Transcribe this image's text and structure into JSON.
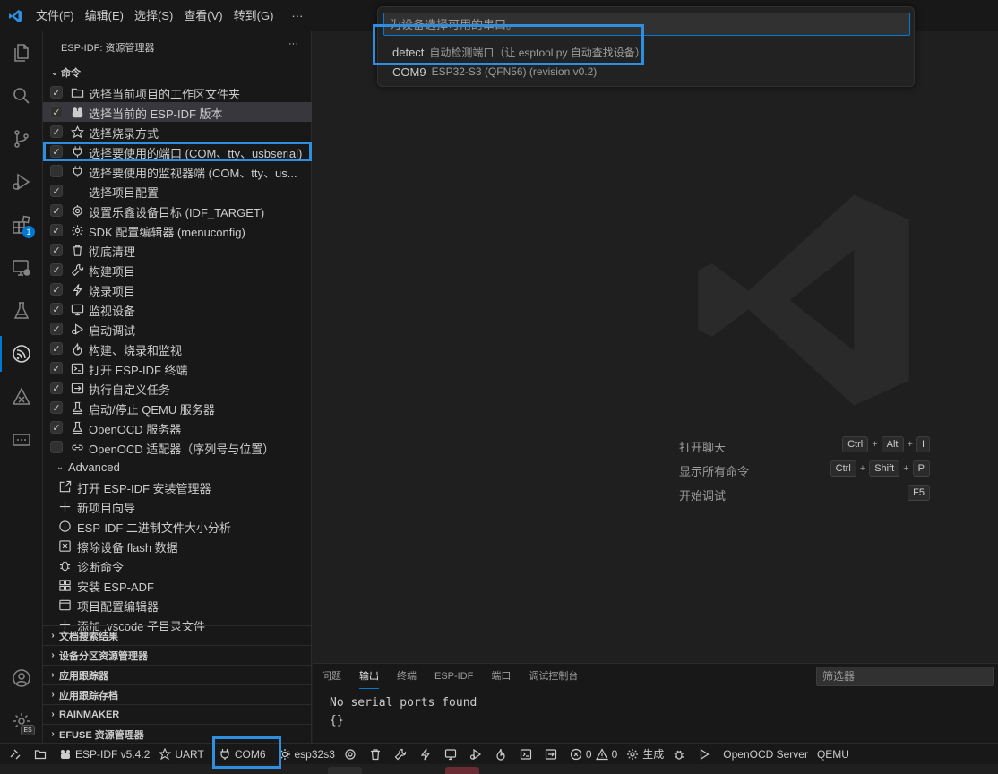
{
  "menu": {
    "items": [
      "文件(F)",
      "编辑(E)",
      "选择(S)",
      "查看(V)",
      "转到(G)",
      "···"
    ]
  },
  "activity": {
    "extensions_badge": "1",
    "settings_badge": "ES"
  },
  "sidebar": {
    "title": "ESP-IDF: 资源管理器",
    "more": "···",
    "section": "命令",
    "commands": [
      {
        "label": "选择当前项目的工作区文件夹",
        "icon": "folder-icon",
        "checked": true
      },
      {
        "label": "选择当前的 ESP-IDF 版本",
        "icon": "espressif-icon",
        "checked": true
      },
      {
        "label": "选择烧录方式",
        "icon": "star-icon",
        "checked": true
      },
      {
        "label": "选择要使用的端口 (COM、tty、usbserial)",
        "icon": "plug-icon",
        "checked": true
      },
      {
        "label": "选择要使用的监视器端 (COM、tty、us...",
        "icon": "plug-icon",
        "checked": false
      },
      {
        "label": "选择项目配置",
        "icon": "",
        "checked": true
      },
      {
        "label": "设置乐鑫设备目标 (IDF_TARGET)",
        "icon": "chip-gear-icon",
        "checked": true
      },
      {
        "label": "SDK 配置编辑器 (menuconfig)",
        "icon": "gear-icon",
        "checked": true
      },
      {
        "label": "彻底清理",
        "icon": "trash-icon",
        "checked": true
      },
      {
        "label": "构建项目",
        "icon": "wrench-icon",
        "checked": true
      },
      {
        "label": "烧录项目",
        "icon": "lightning-icon",
        "checked": true
      },
      {
        "label": "监视设备",
        "icon": "monitor-icon",
        "checked": true
      },
      {
        "label": "启动调试",
        "icon": "debug-icon",
        "checked": true
      },
      {
        "label": "构建、烧录和监视",
        "icon": "flame-icon",
        "checked": true
      },
      {
        "label": "打开 ESP-IDF 终端",
        "icon": "terminal-icon",
        "checked": true
      },
      {
        "label": "执行自定义任务",
        "icon": "run-task-icon",
        "checked": true
      },
      {
        "label": "启动/停止 QEMU 服务器",
        "icon": "server-icon",
        "checked": true
      },
      {
        "label": "OpenOCD 服务器",
        "icon": "server-icon",
        "checked": true
      },
      {
        "label": "OpenOCD 适配器（序列号与位置）",
        "icon": "link-icon",
        "checked": false
      }
    ],
    "advanced": {
      "label": "Advanced",
      "items": [
        {
          "label": "打开 ESP-IDF 安装管理器",
          "icon": "external-icon"
        },
        {
          "label": "新项目向导",
          "icon": "plus-icon"
        },
        {
          "label": "ESP-IDF 二进制文件大小分析",
          "icon": "info-icon"
        },
        {
          "label": "擦除设备 flash 数据",
          "icon": "erase-icon"
        },
        {
          "label": "诊断命令",
          "icon": "bug-icon"
        },
        {
          "label": "安装 ESP-ADF",
          "icon": "package-icon"
        },
        {
          "label": "项目配置编辑器",
          "icon": "window-icon"
        },
        {
          "label": "添加 .vscode 子目录文件",
          "icon": "plus-icon"
        }
      ]
    },
    "sections": [
      "文档搜索结果",
      "设备分区资源管理器",
      "应用跟踪器",
      "应用跟踪存档",
      "RAINMAKER",
      "EFUSE 资源管理器"
    ]
  },
  "quickpick": {
    "placeholder": "为设备选择可用的串口。",
    "items": [
      {
        "label": "detect",
        "description": "自动检测端口（让 esptool.py 自动查找设备）"
      },
      {
        "label": "COM9",
        "description": "ESP32-S3 (QFN56) (revision v0.2)"
      }
    ]
  },
  "welcome": {
    "shortcuts": [
      {
        "label": "打开聊天",
        "keys": [
          "Ctrl",
          "Alt",
          "I"
        ]
      },
      {
        "label": "显示所有命令",
        "keys": [
          "Ctrl",
          "Shift",
          "P"
        ]
      },
      {
        "label": "开始调试",
        "keys": [
          "F5"
        ]
      }
    ],
    "plus": "+"
  },
  "panel": {
    "tabs": [
      "问题",
      "输出",
      "终端",
      "ESP-IDF",
      "端口",
      "调试控制台"
    ],
    "active_tab": "输出",
    "filter_placeholder": "筛选器",
    "output_lines": [
      "No serial ports found",
      "{}"
    ]
  },
  "statusbar": {
    "idf_version": "ESP-IDF v5.4.2",
    "flash_method": "UART",
    "port": "COM6",
    "target": "esp32s3",
    "errors": "0",
    "warnings": "0",
    "build": "生成",
    "openocd": "OpenOCD Server",
    "qemu": "QEMU"
  },
  "colors": {
    "accent": "#0078d4",
    "highlight": "#2f8ee0",
    "background": "#1f1f1f",
    "sidebar": "#181818"
  }
}
